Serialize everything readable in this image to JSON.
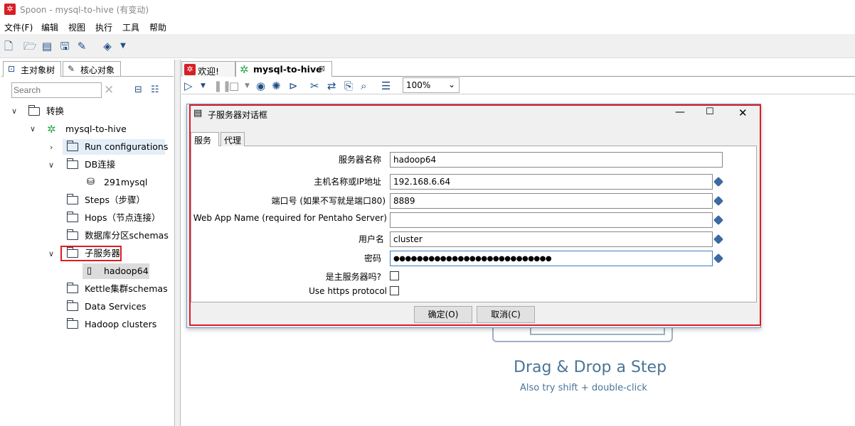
{
  "window": {
    "title": "Spoon - mysql-to-hive (有变动)"
  },
  "menu": [
    "文件(F)",
    "编辑",
    "视图",
    "执行",
    "工具",
    "帮助"
  ],
  "left_tabs": [
    "主对象树",
    "核心对象"
  ],
  "search": {
    "placeholder": "Search"
  },
  "tree": {
    "root": "转换",
    "transform": "mysql-to-hive",
    "run_configs": "Run configurations",
    "db": "DB连接",
    "db_item": "291mysql",
    "steps": "Steps（步骤）",
    "hops": "Hops（节点连接）",
    "partitions": "数据库分区schemas",
    "slaves": "子服务器",
    "slave_item": "hadoop64",
    "clusters": "Kettle集群schemas",
    "data_services": "Data Services",
    "hadoop_clusters": "Hadoop clusters"
  },
  "main_tabs": [
    "欢迎!",
    "mysql-to-hive"
  ],
  "zoom": "100%",
  "dialog": {
    "title": "子服务器对话框",
    "tabs": [
      "服务",
      "代理"
    ],
    "fields": {
      "server_name_label": "服务器名称",
      "server_name": "hadoop64",
      "host_label": "主机名称或IP地址",
      "host": "192.168.6.64",
      "port_label": "端口号 (如果不写就是端口80)",
      "port": "8889",
      "webapp_label": "Web App Name (required for Pentaho Server)",
      "webapp": "",
      "user_label": "用户名",
      "user": "cluster",
      "password_label": "密码",
      "password": "●●●●●●●●●●●●●●●●●●●●●●●●●●●",
      "master_label": "是主服务器吗?",
      "https_label": "Use https protocol"
    },
    "ok": "确定(O)",
    "cancel": "取消(C)"
  },
  "canvas": {
    "hint": "Drag & Drop a Step",
    "subhint": "Also try shift + double-click"
  }
}
